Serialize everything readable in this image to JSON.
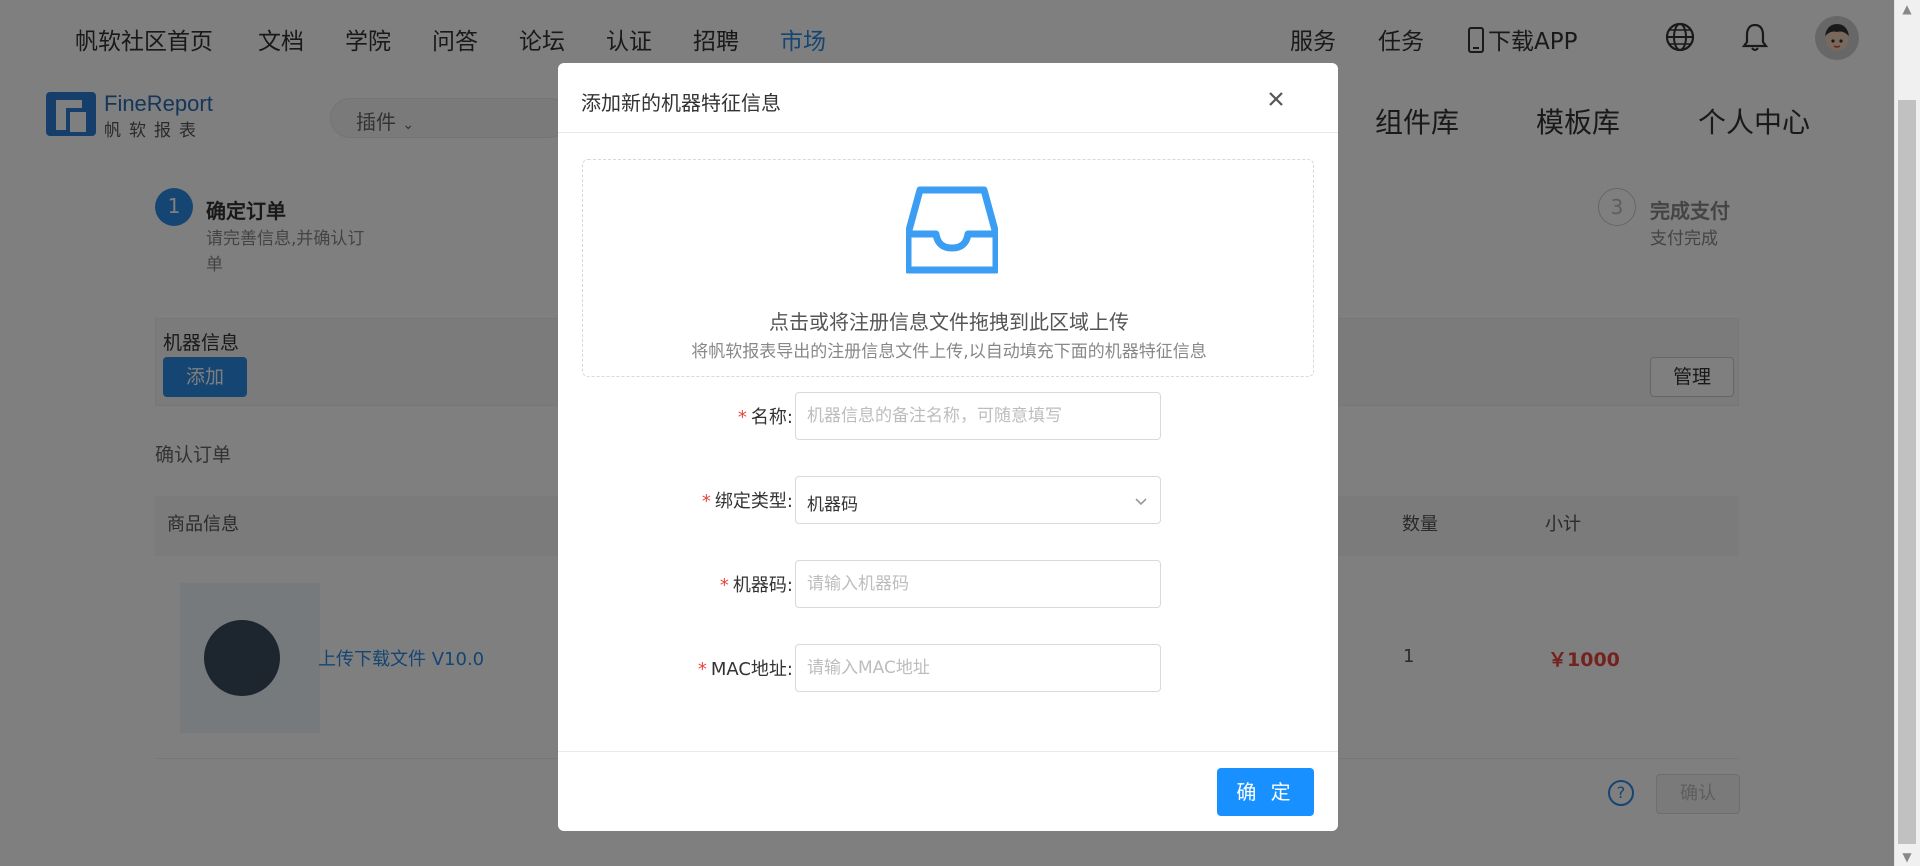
{
  "topnav": {
    "items": [
      "帆软社区首页",
      "文档",
      "学院",
      "问答",
      "论坛",
      "认证",
      "招聘",
      "市场"
    ],
    "active_item": "市场",
    "right_items": [
      "服务",
      "任务",
      "下载APP"
    ]
  },
  "subnav": {
    "logo_brand": "FineReport",
    "logo_cn": "帆软报表",
    "search_category": "插件",
    "items": [
      "组件库",
      "模板库",
      "个人中心"
    ]
  },
  "steps": [
    {
      "num": "1",
      "title": "确定订单",
      "desc": "请完善信息,并确认订单"
    },
    {
      "num": "3",
      "title": "完成支付",
      "desc": "支付完成"
    }
  ],
  "machine_info": {
    "label": "机器信息",
    "add_button": "添加",
    "manage_button": "管理"
  },
  "order": {
    "section_label": "确认订单",
    "columns": {
      "product": "商品信息",
      "qty": "数量",
      "subtotal": "小计"
    },
    "product_name": "上传下载文件 V10.0",
    "quantity": "1",
    "price": "￥1000",
    "confirm_button": "确认"
  },
  "modal": {
    "title": "添加新的机器特征信息",
    "upload": {
      "text": "点击或将注册信息文件拖拽到此区域上传",
      "hint": "将帆软报表导出的注册信息文件上传,以自动填充下面的机器特征信息"
    },
    "fields": {
      "name": {
        "label": "名称:",
        "placeholder": "机器信息的备注名称，可随意填写"
      },
      "bind_type": {
        "label": "绑定类型:",
        "value": "机器码"
      },
      "machine_code": {
        "label": "机器码:",
        "placeholder": "请输入机器码"
      },
      "mac": {
        "label": "MAC地址:",
        "placeholder": "请输入MAC地址"
      }
    },
    "ok_button": "确 定"
  },
  "colors": {
    "primary": "#1890ff",
    "required": "#e8453c",
    "overlay": "rgba(0,0,0,0.5)"
  }
}
